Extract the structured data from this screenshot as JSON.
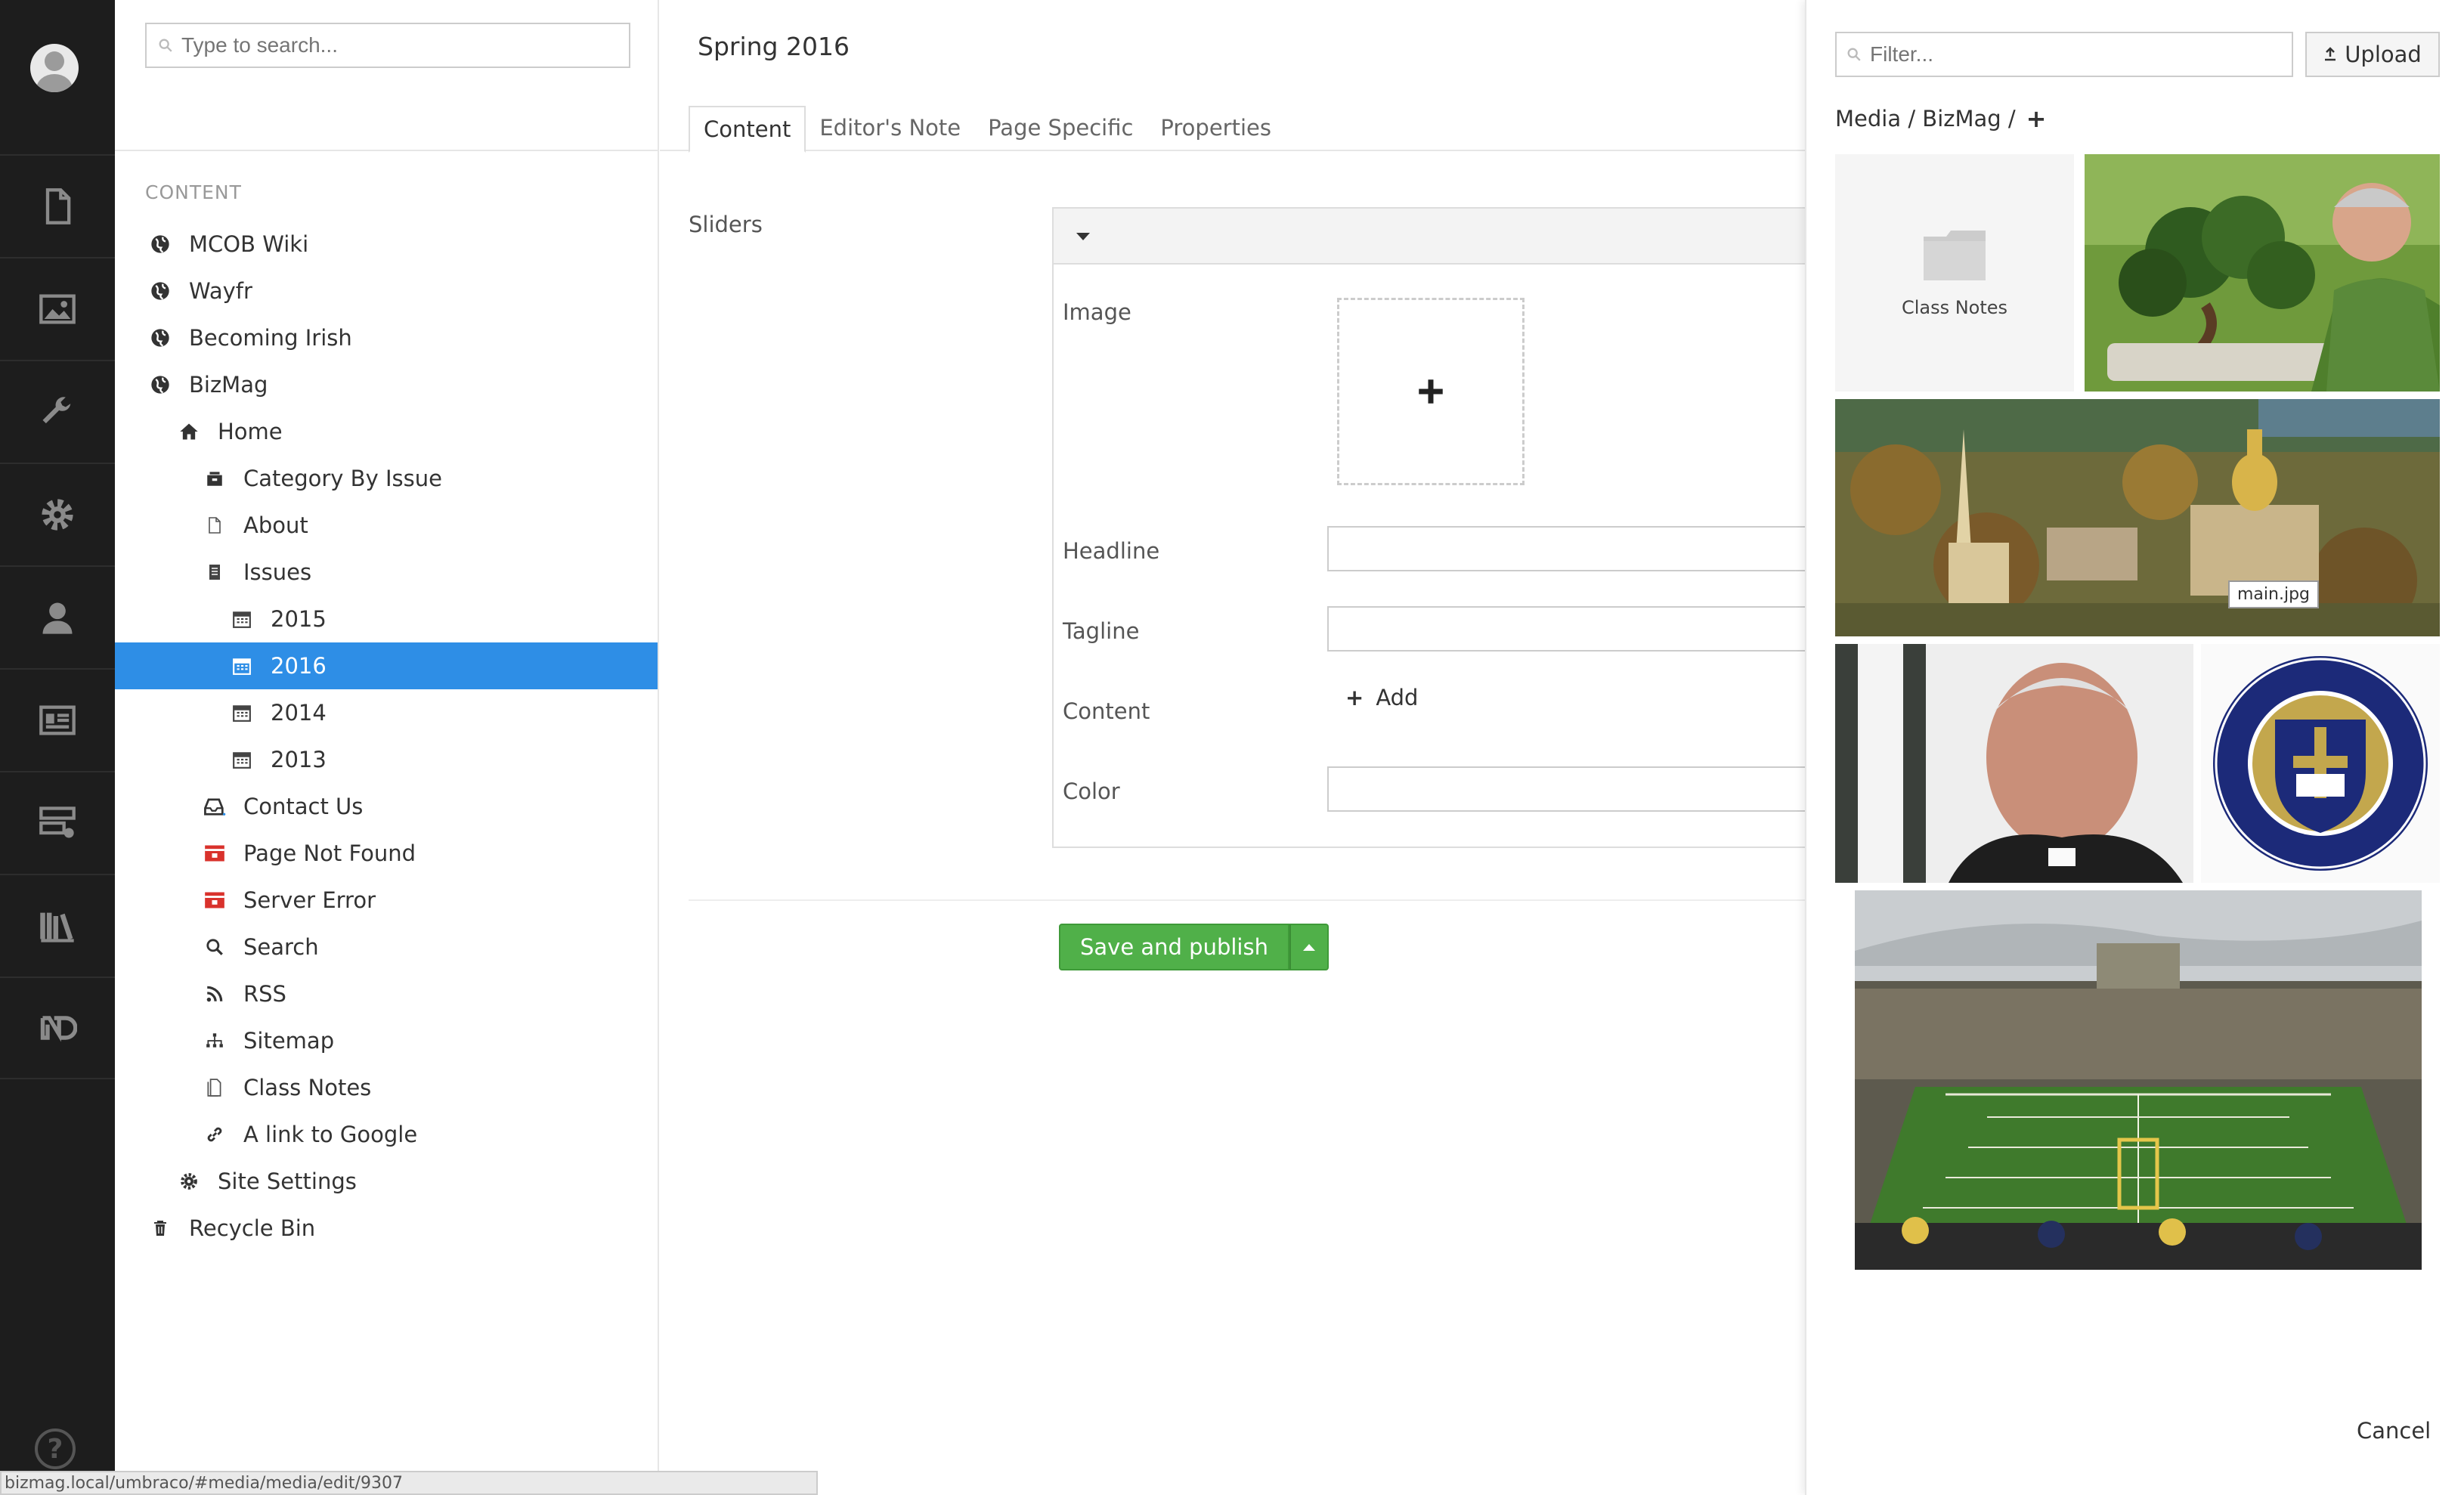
{
  "sections": {
    "items": [
      "content",
      "media",
      "settings",
      "developer",
      "users",
      "members",
      "forms",
      "translation",
      "nd"
    ]
  },
  "tree": {
    "search_placeholder": "Type to search...",
    "heading": "CONTENT",
    "nodes": [
      {
        "label": "MCOB Wiki",
        "icon": "globe-icon"
      },
      {
        "label": "Wayfr",
        "icon": "globe-icon"
      },
      {
        "label": "Becoming Irish",
        "icon": "globe-icon"
      },
      {
        "label": "BizMag",
        "icon": "globe-icon"
      },
      {
        "label": "Home",
        "icon": "home-icon"
      },
      {
        "label": "Category By Issue",
        "icon": "folder-icon"
      },
      {
        "label": "About",
        "icon": "document-icon"
      },
      {
        "label": "Issues",
        "icon": "list-icon"
      },
      {
        "label": "2015",
        "icon": "calendar-icon"
      },
      {
        "label": "2016",
        "icon": "calendar-icon",
        "selected": true
      },
      {
        "label": "2014",
        "icon": "calendar-icon"
      },
      {
        "label": "2013",
        "icon": "calendar-icon"
      },
      {
        "label": "Contact Us",
        "icon": "inbox-icon"
      },
      {
        "label": "Page Not Found",
        "icon": "error-icon"
      },
      {
        "label": "Server Error",
        "icon": "error-icon"
      },
      {
        "label": "Search",
        "icon": "search-icon"
      },
      {
        "label": "RSS",
        "icon": "rss-icon"
      },
      {
        "label": "Sitemap",
        "icon": "sitemap-icon"
      },
      {
        "label": "Class Notes",
        "icon": "notes-icon"
      },
      {
        "label": "A link to Google",
        "icon": "link-icon"
      },
      {
        "label": "Site Settings",
        "icon": "gear-icon"
      },
      {
        "label": "Recycle Bin",
        "icon": "trash-icon"
      }
    ]
  },
  "editor": {
    "title": "Spring 2016",
    "tabs": [
      "Content",
      "Editor's Note",
      "Page Specific",
      "Properties"
    ],
    "sliders_label": "Sliders",
    "fields": {
      "image": "Image",
      "headline": "Headline",
      "tagline": "Tagline",
      "content": "Content",
      "color": "Color"
    },
    "add_label": "Add",
    "save_label": "Save and publish"
  },
  "media": {
    "filter_placeholder": "Filter...",
    "upload_label": "Upload",
    "breadcrumb": "Media / BizMag /",
    "folder_label": "Class Notes",
    "tooltip": "main.jpg",
    "cancel_label": "Cancel"
  },
  "status_url": "bizmag.local/umbraco/#media/media/edit/9307",
  "colors": {
    "selected": "#2e8ee6",
    "save": "#50b049",
    "sidebar": "#1d1d1d"
  }
}
